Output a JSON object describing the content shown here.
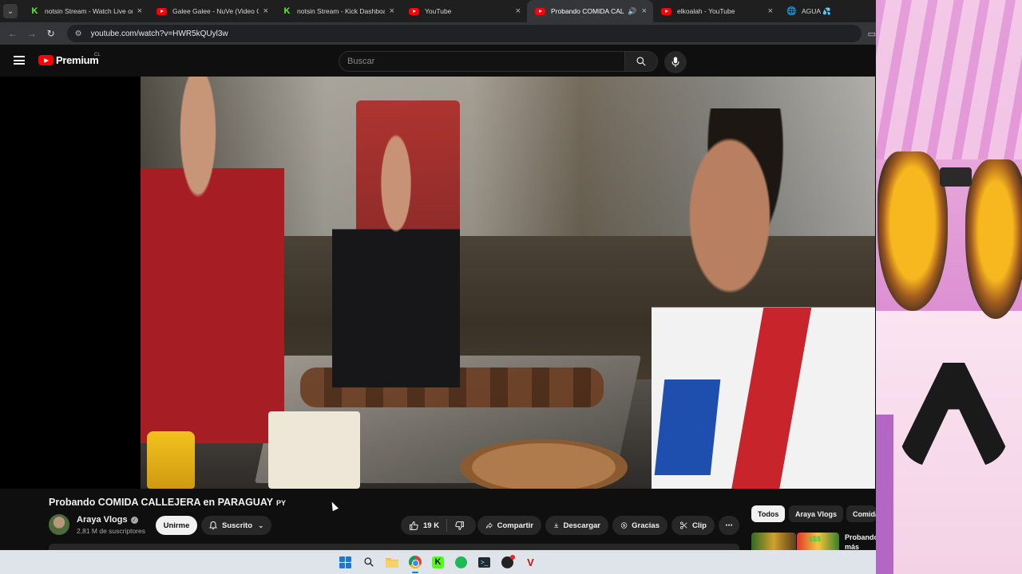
{
  "browser": {
    "tabs": [
      {
        "label": "notsin Stream - Watch Live on K",
        "icon": "kick-icon",
        "active": false,
        "close": "×"
      },
      {
        "label": "Galee Galee - NuVe (Video Ofic",
        "icon": "youtube-icon",
        "active": false,
        "close": "×"
      },
      {
        "label": "notsin Stream - Kick Dashboard",
        "icon": "kick-icon",
        "active": false,
        "close": "×"
      },
      {
        "label": "YouTube",
        "icon": "youtube-icon",
        "active": false,
        "close": "×"
      },
      {
        "label": "Probando COMIDA CALLEJE",
        "icon": "youtube-icon",
        "active": true,
        "close": "×",
        "audio": "🔊"
      },
      {
        "label": "elkoalah - YouTube",
        "icon": "youtube-icon",
        "active": false,
        "close": "×"
      },
      {
        "label": "AGUA 💦",
        "icon": "globe-icon",
        "active": false,
        "close": ""
      }
    ],
    "url": "youtube.com/watch?v=HWR5kQUyl3w"
  },
  "masthead": {
    "logo_text": "Premium",
    "region": "CL",
    "search_placeholder": "Buscar"
  },
  "video": {
    "title": "Probando COMIDA CALLEJERA en PARAGUAY",
    "title_flag": "PY"
  },
  "channel": {
    "name": "Araya Vlogs",
    "subscribers": "2,81 M de suscriptores",
    "join_label": "Unirme",
    "subscribed_label": "Suscrito"
  },
  "actions": {
    "likes": "19 K",
    "share": "Compartir",
    "download": "Descargar",
    "thanks": "Gracias",
    "clip": "Clip",
    "more": "⋯"
  },
  "related": {
    "chips": [
      "Todos",
      "Araya Vlogs",
      "Comida"
    ],
    "first_title": "Probando más BARATO",
    "thumb_badge": "$$$"
  },
  "colors": {
    "background": "#0f0f0f",
    "brand_red": "#ff0000",
    "kick_green": "#53fc18"
  }
}
